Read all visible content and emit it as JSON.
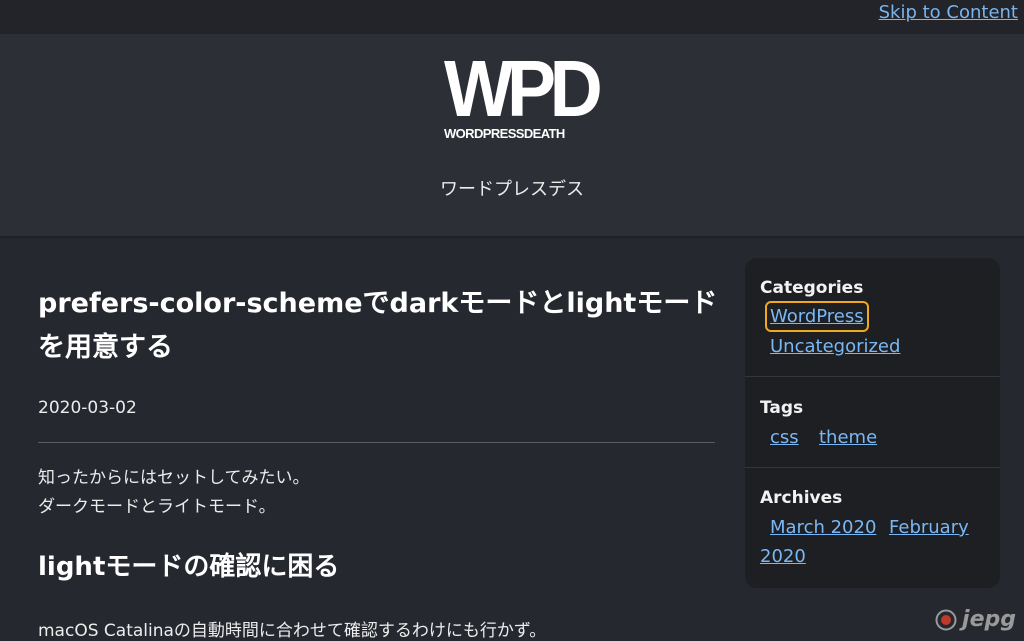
{
  "skip_link": "Skip to Content",
  "site": {
    "logo_text": "WPD",
    "logo_subtext": "WORDPRESSDEATH",
    "tagline": "ワードプレスデス"
  },
  "post": {
    "title": "prefers-color-schemeでdarkモードとlightモードを用意する",
    "date": "2020-03-02",
    "para1_line1": "知ったからにはセットしてみたい。",
    "para1_line2": "ダークモードとライトモード。",
    "h2": "lightモードの確認に困る",
    "para2": "macOS Catalinaの自動時間に合わせて確認するわけにも行かず。"
  },
  "sidebar": {
    "categories_title": "Categories",
    "categories": [
      "WordPress",
      "Uncategorized"
    ],
    "tags_title": "Tags",
    "tags": [
      "css",
      "theme"
    ],
    "archives_title": "Archives",
    "archives": [
      "March 2020",
      "February",
      "2020"
    ]
  },
  "watermark": "jepg",
  "colors": {
    "background": "#26282f",
    "header": "#2d2f36",
    "sidebar": "#1d1f23",
    "link": "#7ab8f5",
    "focus_ring": "#f0a91c"
  }
}
